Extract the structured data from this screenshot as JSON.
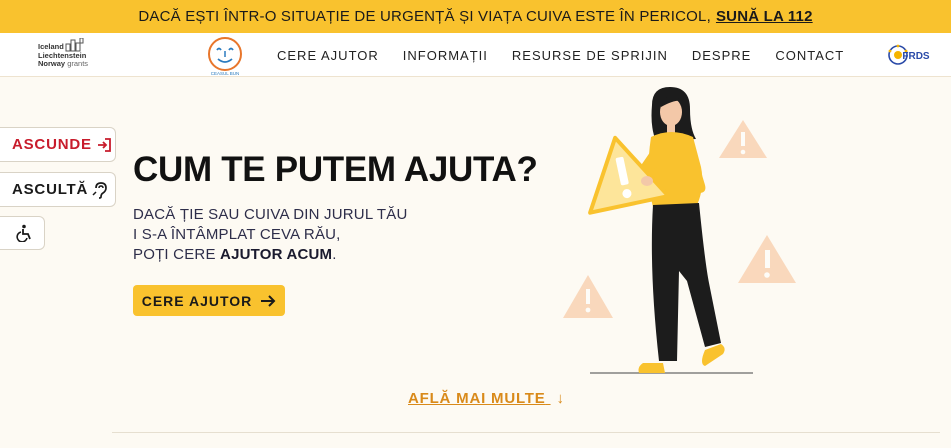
{
  "banner": {
    "text": "DACĂ EȘTI ÎNTR-O SITUAȚIE DE URGENȚĂ ȘI VIAȚA CUIVA ESTE ÎN PERICOL,",
    "call_label": "SUNĂ LA 112"
  },
  "header": {
    "eea_logo": {
      "line1": "Iceland",
      "line2": "Liechtenstein",
      "line3": "Norway",
      "line3b": "grants"
    },
    "brand_logo_text": "CEASUL BUN",
    "menu": [
      "CERE AJUTOR",
      "INFORMAȚII",
      "RESURSE DE SPRIJIN",
      "DESPRE",
      "CONTACT"
    ],
    "partner_logo_text": "FRDS"
  },
  "side_tools": {
    "hide_label": "ASCUNDE",
    "listen_label": "ASCULTĂ"
  },
  "hero": {
    "title": "CUM TE PUTEM AJUTA?",
    "line1": "DACĂ ȚIE SAU CUIVA DIN JURUL TĂU",
    "line2": "I S-A ÎNTÂMPLAT CEVA RĂU,",
    "line3_prefix": "POȚI CERE",
    "line3_bold": "AJUTOR ACUM",
    "line3_suffix": ".",
    "cta_label": "CERE AJUTOR"
  },
  "more_link": "AFLĂ MAI MULTE",
  "colors": {
    "accent": "#f9c22e",
    "danger": "#c81c2c",
    "link": "#d98a1a",
    "background": "#fdfaf3"
  },
  "icons": {
    "hide": "exit-arrow-icon",
    "listen": "hearing-icon",
    "accessibility": "wheelchair-icon",
    "cta": "arrow-right-icon",
    "more": "arrow-down-icon"
  }
}
